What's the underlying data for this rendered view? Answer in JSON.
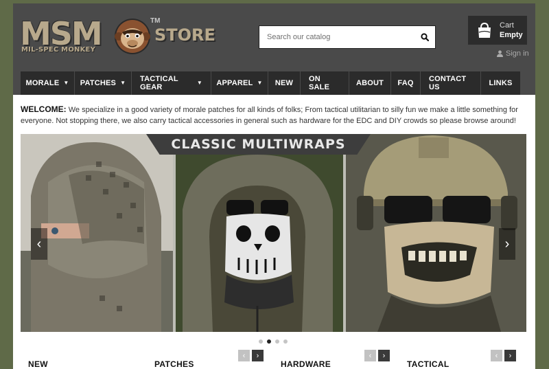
{
  "logo": {
    "msm": "MSM",
    "tagline": "MIL-SPEC MONKEY",
    "tm": "TM",
    "store": "STORE"
  },
  "search": {
    "placeholder": "Search our catalog",
    "icon": "search-icon"
  },
  "cart": {
    "title": "Cart",
    "status": "Empty",
    "icon": "shopping-bag-icon"
  },
  "account": {
    "signin_label": "Sign in",
    "icon": "user-icon"
  },
  "nav": {
    "items": [
      {
        "label": "MORALE",
        "dropdown": true
      },
      {
        "label": "PATCHES",
        "dropdown": true
      },
      {
        "label": "TACTICAL GEAR",
        "dropdown": true
      },
      {
        "label": "APPAREL",
        "dropdown": true
      },
      {
        "label": "NEW",
        "dropdown": false
      },
      {
        "label": "ON SALE",
        "dropdown": false
      },
      {
        "label": "ABOUT",
        "dropdown": false
      },
      {
        "label": "FAQ",
        "dropdown": false
      },
      {
        "label": "CONTACT US",
        "dropdown": false
      },
      {
        "label": "LINKS",
        "dropdown": false
      }
    ]
  },
  "welcome": {
    "heading": "WELCOME:",
    "text": "We specialize in a good variety of morale patches for all kinds of folks; From tactical utilitarian to silly fun we make a little something for everyone. Not stopping there, we also carry tactical accessories in general such as hardware for the EDC and DIY crowds so please browse around!"
  },
  "slider": {
    "banner": "CLASSIC MULTIWRAPS",
    "prev_icon": "chevron-left-icon",
    "next_icon": "chevron-right-icon",
    "slide_count": 4,
    "active_slide": 2
  },
  "categories": [
    {
      "label": "NEW"
    },
    {
      "label": "PATCHES"
    },
    {
      "label": "HARDWARE"
    },
    {
      "label": "TACTICAL"
    }
  ],
  "colors": {
    "background": "#5f6a48",
    "header": "#4a4a4a",
    "nav": "#2b2b2b",
    "logo_tan": "#b8a98c"
  }
}
